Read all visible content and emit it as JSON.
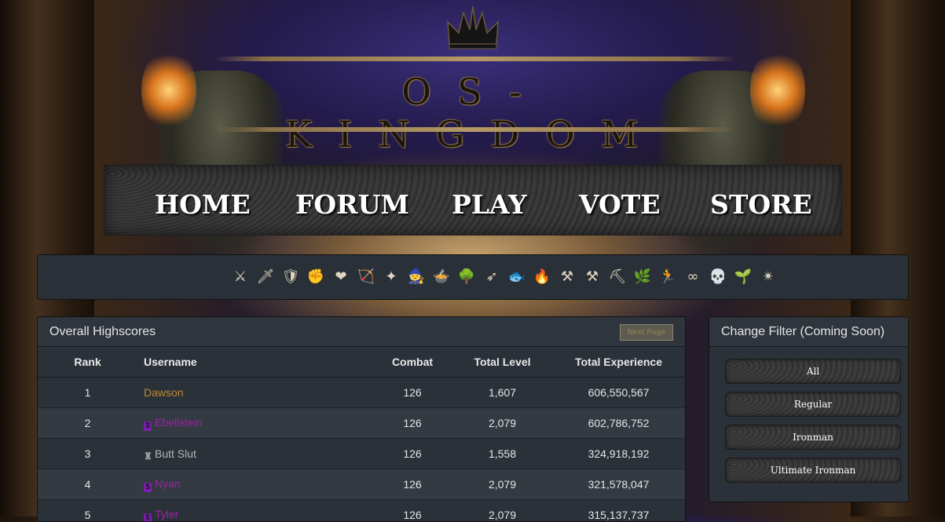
{
  "logo": {
    "text": "OS-KINGDOM"
  },
  "nav": {
    "items": [
      {
        "label": "HOME"
      },
      {
        "label": "FORUM"
      },
      {
        "label": "PLAY"
      },
      {
        "label": "VOTE"
      },
      {
        "label": "STORE"
      }
    ]
  },
  "skills": [
    {
      "name": "overall",
      "glyph": "⚔"
    },
    {
      "name": "attack",
      "glyph": "🗡"
    },
    {
      "name": "defence",
      "glyph": "🛡"
    },
    {
      "name": "strength",
      "glyph": "✊"
    },
    {
      "name": "hitpoints",
      "glyph": "❤"
    },
    {
      "name": "ranged",
      "glyph": "🏹"
    },
    {
      "name": "prayer",
      "glyph": "✦"
    },
    {
      "name": "magic",
      "glyph": "🧙"
    },
    {
      "name": "cooking",
      "glyph": "🍲"
    },
    {
      "name": "woodcutting",
      "glyph": "🌳"
    },
    {
      "name": "fletching",
      "glyph": "➶"
    },
    {
      "name": "fishing",
      "glyph": "🐟"
    },
    {
      "name": "firemaking",
      "glyph": "🔥"
    },
    {
      "name": "crafting",
      "glyph": "⚒"
    },
    {
      "name": "smithing",
      "glyph": "⚒"
    },
    {
      "name": "mining",
      "glyph": "⛏"
    },
    {
      "name": "herblore",
      "glyph": "🌿"
    },
    {
      "name": "agility",
      "glyph": "🏃"
    },
    {
      "name": "thieving",
      "glyph": "∞"
    },
    {
      "name": "slayer",
      "glyph": "💀"
    },
    {
      "name": "farming",
      "glyph": "🌱"
    },
    {
      "name": "runecrafting",
      "glyph": "✴"
    }
  ],
  "highscores": {
    "title": "Overall Highscores",
    "next_label": "Next Page",
    "columns": {
      "rank": "Rank",
      "username": "Username",
      "combat": "Combat",
      "total_level": "Total Level",
      "total_experience": "Total Experience"
    },
    "rows": [
      {
        "rank": "1",
        "username": "Dawson",
        "combat": "126",
        "total_level": "1,607",
        "total_experience": "606,550,567"
      },
      {
        "rank": "2",
        "username": "Ebellstein",
        "combat": "126",
        "total_level": "2,079",
        "total_experience": "602,786,752"
      },
      {
        "rank": "3",
        "username": "Butt Slut",
        "combat": "126",
        "total_level": "1,558",
        "total_experience": "324,918,192"
      },
      {
        "rank": "4",
        "username": "Nyan",
        "combat": "126",
        "total_level": "2,079",
        "total_experience": "321,578,047"
      },
      {
        "rank": "5",
        "username": "Tyler",
        "combat": "126",
        "total_level": "2,079",
        "total_experience": "315,137,737"
      }
    ]
  },
  "filter": {
    "title": "Change Filter (Coming Soon)",
    "buttons": [
      {
        "label": "All"
      },
      {
        "label": "Regular"
      },
      {
        "label": "Ironman"
      },
      {
        "label": "Ultimate Ironman"
      }
    ]
  },
  "colors": {
    "gold_user": "#b8893a",
    "donator_purple": "#a01fa8",
    "panel_bg": "#2b3138"
  }
}
